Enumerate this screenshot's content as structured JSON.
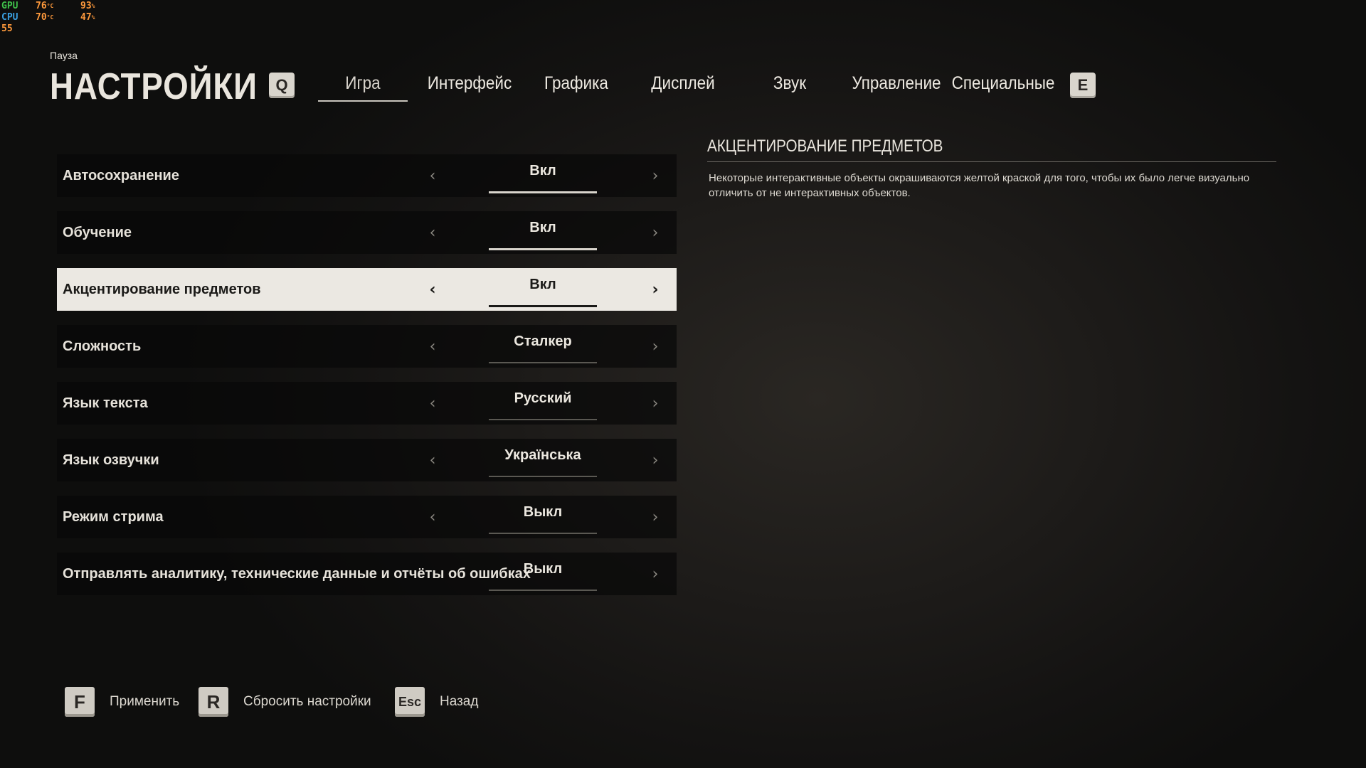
{
  "overlay": {
    "gpu_label": "GPU",
    "gpu_temp": "76",
    "gpu_temp_unit": "°C",
    "gpu_load": "93",
    "gpu_load_unit": "%",
    "cpu_label": "CPU",
    "cpu_temp": "70",
    "cpu_temp_unit": "°C",
    "cpu_load": "47",
    "cpu_load_unit": "%",
    "fps": "55"
  },
  "header": {
    "pause": "Пауза",
    "title": "НАСТРОЙКИ",
    "prev_key": "Q",
    "next_key": "E"
  },
  "tabs": [
    {
      "label": "Игра",
      "active": true
    },
    {
      "label": "Интерфейс"
    },
    {
      "label": "Графика"
    },
    {
      "label": "Дисплей"
    },
    {
      "label": "Звук"
    },
    {
      "label": "Управление"
    },
    {
      "label": "Специальные"
    }
  ],
  "settings": [
    {
      "label": "Автосохранение",
      "value": "Вкл"
    },
    {
      "label": "Обучение",
      "value": "Вкл"
    },
    {
      "label": "Акцентирование предметов",
      "value": "Вкл",
      "selected": true
    },
    {
      "label": "Сложность",
      "value": "Сталкер"
    },
    {
      "label": "Язык текста",
      "value": "Русский"
    },
    {
      "label": "Язык озвучки",
      "value": "Українська"
    },
    {
      "label": "Режим стрима",
      "value": "Выкл"
    },
    {
      "label": "Отправлять аналитику, технические данные и отчёты об ошибках",
      "value": "Выкл"
    }
  ],
  "arrows": {
    "left": "‹",
    "right": "›"
  },
  "description": {
    "title": "АКЦЕНТИРОВАНИЕ ПРЕДМЕТОВ",
    "text": "Некоторые интерактивные объекты окрашиваются желтой краской для того, чтобы их было легче визуально отличить от не интерактивных объектов."
  },
  "footer": [
    {
      "key": "F",
      "label": "Применить"
    },
    {
      "key": "R",
      "label": "Сбросить настройки"
    },
    {
      "key": "Esc",
      "label": "Назад"
    }
  ]
}
